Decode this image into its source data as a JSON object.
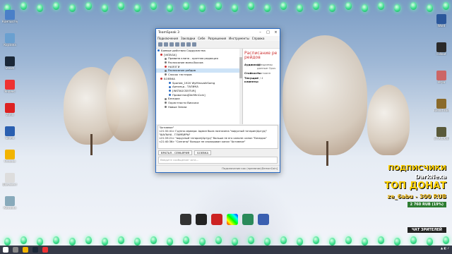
{
  "window": {
    "title": "TeamSpeak 3",
    "menu": [
      "Подключения",
      "Закладки",
      "Себе",
      "Разрешения",
      "Инструменты",
      "Справка"
    ],
    "channels": [
      {
        "label": "Боевые действия Содружества",
        "color": "#2b6cc4"
      },
      {
        "label": "[VATAGA]",
        "color": "#c33"
      },
      {
        "label": "Правила клана - кротная редакция",
        "color": "#777"
      },
      {
        "label": "Расписание мини-боссов",
        "color": "#777"
      },
      {
        "label": "НАЛОГИ",
        "color": "#c33"
      },
      {
        "label": "Расписание рейдов",
        "color": "#777",
        "selected": true
      },
      {
        "label": "Список тестеров",
        "color": "#777"
      },
      {
        "label": "БОЕВКА",
        "color": "#c33"
      },
      {
        "label": "Spartak_1920 WyMirovalkSomg",
        "color": "#2b6cc4"
      },
      {
        "label": "Арнольд - ТАЛИКА",
        "color": "#2b6cc4"
      },
      {
        "label": "[INSTAGCSEITUR]",
        "color": "#2b6cc4"
      },
      {
        "label": "Приватная[DerMinCoin]",
        "color": "#2b6cc4"
      },
      {
        "label": "Беседка",
        "color": "#777"
      },
      {
        "label": "Окрестности Вискиса",
        "color": "#777"
      },
      {
        "label": "Новые Земли",
        "color": "#777"
      }
    ],
    "info": {
      "header": "Расписание ре рейдов",
      "rows": [
        {
          "k": "Аудиокод:",
          "v": "Обещаемы данные Opus"
        },
        {
          "k": "Стойкость:",
          "v": "Постоянн"
        },
        {
          "k": "Текущие клиенты:",
          "v": "0 / 4"
        }
      ]
    },
    "chat": [
      "\"Активное\"",
      "<21:32:41> Группа сервера: Админ была назначена \"вирусный татарин(Артур)\"",
      "\"ШАЛЬНА - ГЛАМБИРЫ\"",
      "<21:33:21> \"вирусный татарин(Артур)\" больше не его канале: канал \"Беседка\"",
      "<21:40:36> \"Сангины\" больше не изолирован канал \"Активное\""
    ],
    "chat_tabs": [
      "ВРАТЬЯ - СЕМЬЯРИЯ",
      "БОЕВКА"
    ],
    "chat_placeholder": "Введите сообщение чата...",
    "status": "Подключение как (преемник)DemonCoin]"
  },
  "desktop_icons": [
    {
      "label": "Компьютер",
      "color": "#4a80c8"
    },
    {
      "label": "Корзина",
      "color": "#6aa0d0"
    },
    {
      "label": "Steam",
      "color": "#1b2838"
    },
    {
      "label": "Яндекс",
      "color": "#e33"
    },
    {
      "label": "Zona",
      "color": "#d22"
    },
    {
      "label": "Sigma",
      "color": "#2a5fb0"
    },
    {
      "label": "Chrome",
      "color": "#f2b400"
    },
    {
      "label": "Документ",
      "color": "#ddd"
    },
    {
      "label": "Корзина",
      "color": "#8ab"
    }
  ],
  "right_icons": [
    {
      "label": "Word",
      "color": "#2b579a"
    },
    {
      "label": "Fallout",
      "color": "#2a2a2a"
    },
    {
      "label": "Игра",
      "color": "#c66"
    },
    {
      "label": "Fallout Earth",
      "color": "#8a6a2a"
    },
    {
      "label": "S.T.A.L.K.E.R.",
      "color": "#5a5a3a"
    }
  ],
  "overlay": {
    "subs_label": "ПОДПИСЧИКИ",
    "subs_name": "DarkNexa",
    "top_label": "ТОП ДОНАТ",
    "top_value": "ze_6abu - 300 RUB",
    "goal": "2 760 RUB (19%)",
    "chat_label": "ЧАТ ЗРИТЕЛЕЙ"
  },
  "colors": {
    "window_border": "#2b6cc4",
    "selected_channel": "#cde3f7",
    "taskbar": "#141928"
  }
}
